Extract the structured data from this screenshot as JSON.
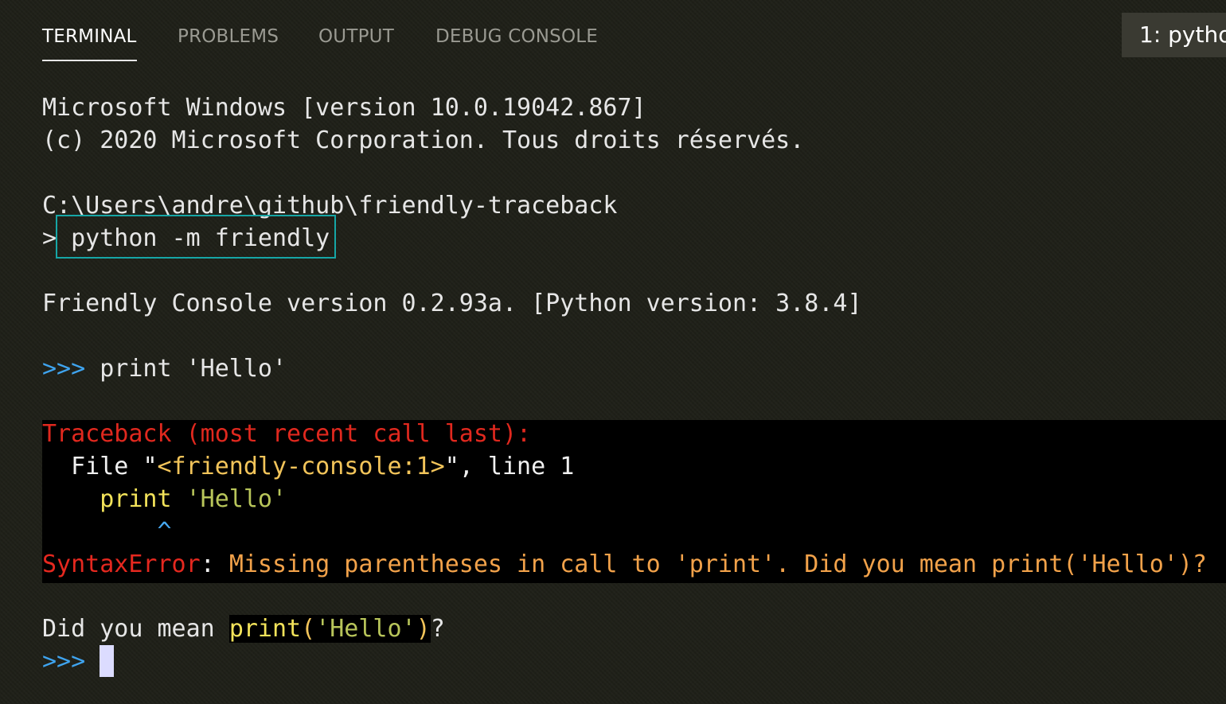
{
  "tabs": {
    "terminal": "TERMINAL",
    "problems": "PROBLEMS",
    "output": "OUTPUT",
    "debug_console": "DEBUG CONSOLE",
    "active": "TERMINAL"
  },
  "terminal_selector": {
    "value": "1: pytho"
  },
  "terminal_lines": {
    "windows_version": "Microsoft Windows [version 10.0.19042.867]",
    "copyright": "(c) 2020 Microsoft Corporation. Tous droits réservés.",
    "cwd": "C:\\Users\\andre\\github\\friendly-traceback",
    "shell_prompt": ">",
    "command": "python -m friendly",
    "friendly_banner": "Friendly Console version 0.2.93a. [Python version: 3.8.4]",
    "repl_prompt": ">>>",
    "user_input": "print 'Hello'"
  },
  "traceback": {
    "header": "Traceback (most recent call last):",
    "file_prefix": "  File ",
    "file_name": "\"<friendly-console:1>\"",
    "file_sep": ", ",
    "line_info": "line 1",
    "code_indent": "    ",
    "code_keyword": "print",
    "code_space": " ",
    "code_string": "'Hello'",
    "caret": "        ^",
    "error_type": "SyntaxError",
    "error_colon": ": ",
    "error_message": "Missing parentheses in call to 'print'. Did you mean print('Hello')?"
  },
  "hint": {
    "prefix": "Did you mean ",
    "code_func": "print",
    "code_open": "(",
    "code_string": "'Hello'",
    "code_close": ")",
    "suffix": "?"
  },
  "final_prompt": ">>>",
  "colors": {
    "background": "#1f2018",
    "prompt_blue": "#3fa4ef",
    "error_red": "#e5281f",
    "message_orange": "#f2a24a",
    "highlight_teal": "#16a6a6",
    "cursor": "#dcdcff"
  }
}
